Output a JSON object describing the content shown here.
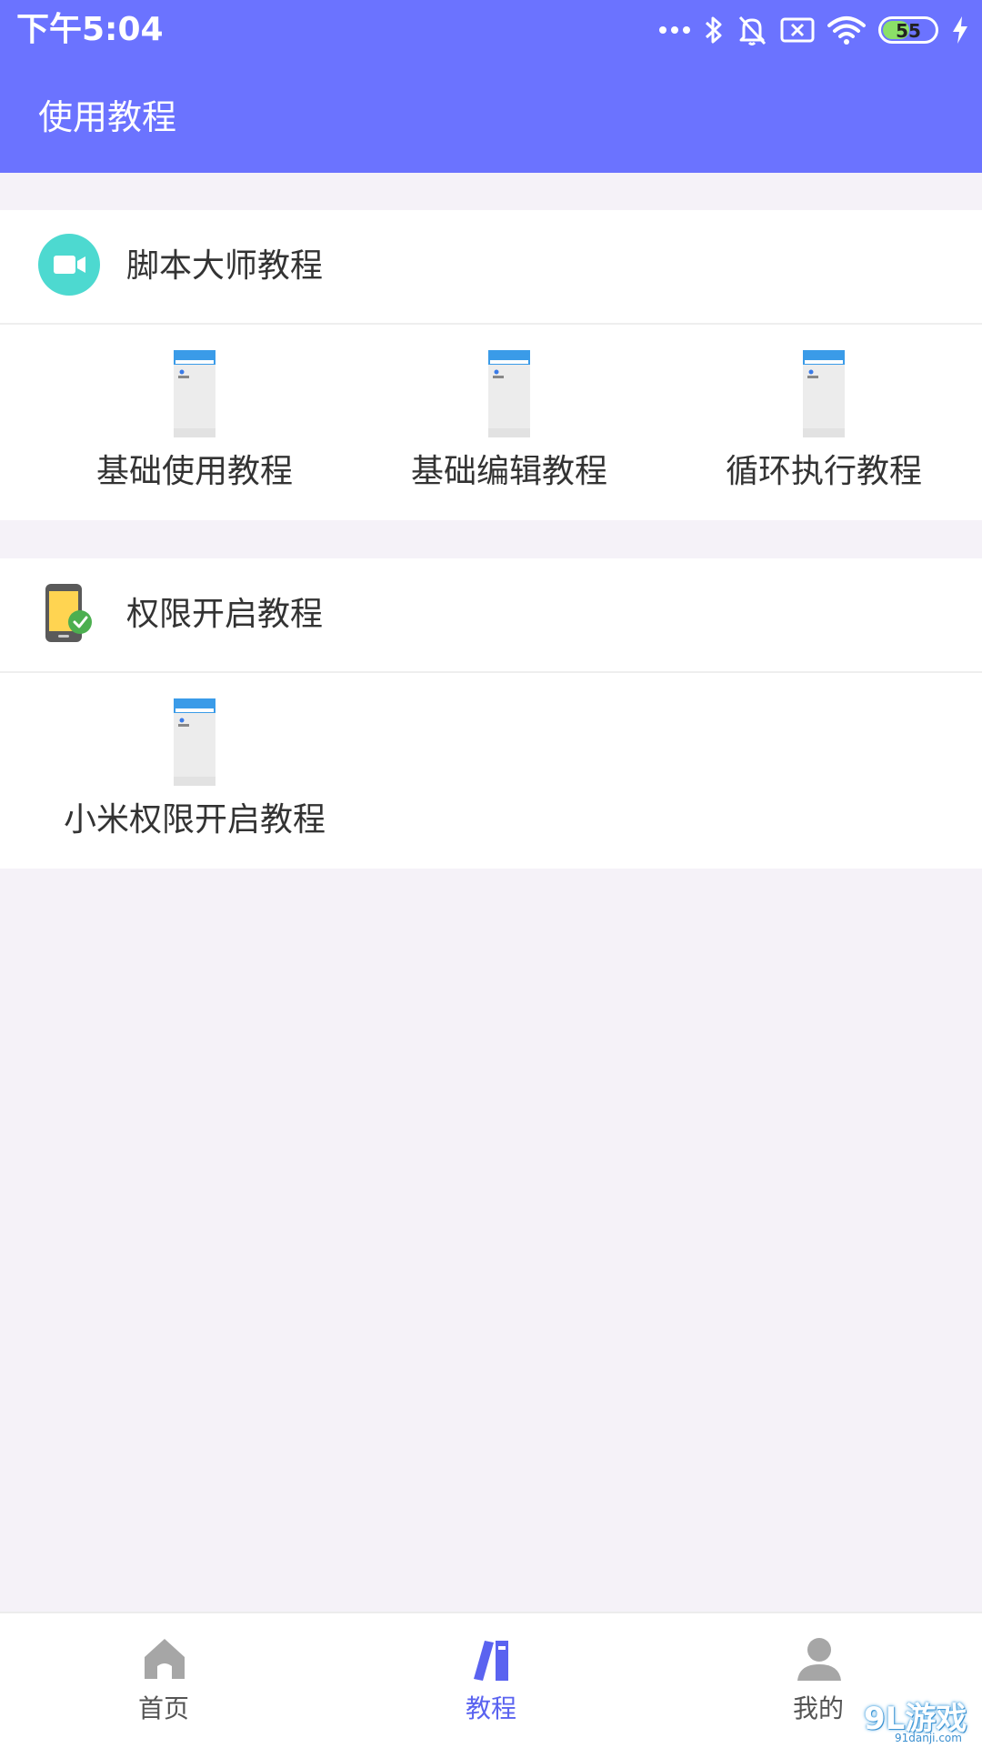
{
  "status": {
    "time": "下午5:04",
    "battery": "55",
    "battery_level": 0.55
  },
  "header": {
    "title": "使用教程"
  },
  "sections": [
    {
      "title": "脚本大师教程",
      "icon": "video-camera-icon",
      "icon_color": "#4dd9d0",
      "items": [
        {
          "label": "基础使用教程"
        },
        {
          "label": "基础编辑教程"
        },
        {
          "label": "循环执行教程"
        }
      ]
    },
    {
      "title": "权限开启教程",
      "icon": "phone-check-icon",
      "items": [
        {
          "label": "小米权限开启教程"
        }
      ]
    }
  ],
  "nav": {
    "items": [
      {
        "label": "首页",
        "icon": "home-icon"
      },
      {
        "label": "教程",
        "icon": "books-icon",
        "active": true
      },
      {
        "label": "我的",
        "icon": "profile-icon"
      }
    ]
  },
  "watermark": {
    "text": "9L游戏",
    "sub": "91danji.com"
  },
  "colors": {
    "header": "#6b73ff",
    "active": "#5a63f0",
    "background": "#f5f2f8"
  }
}
